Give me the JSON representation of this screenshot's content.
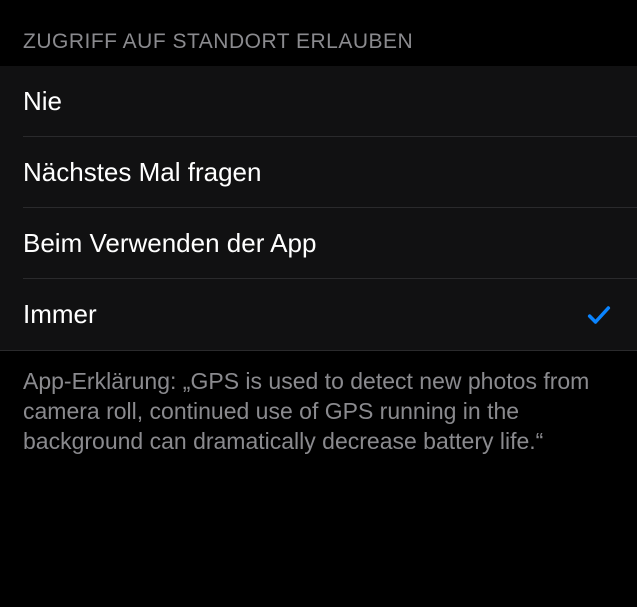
{
  "section_header": "Zugriff auf Standort erlauben",
  "options": [
    {
      "label": "Nie",
      "selected": false
    },
    {
      "label": "Nächstes Mal fragen",
      "selected": false
    },
    {
      "label": "Beim Verwenden der App",
      "selected": false
    },
    {
      "label": "Immer",
      "selected": true
    }
  ],
  "footer": "App-Erklärung: „GPS is used to detect new photos from camera roll, continued use of GPS running in the background can dramatically decrease battery life.“"
}
